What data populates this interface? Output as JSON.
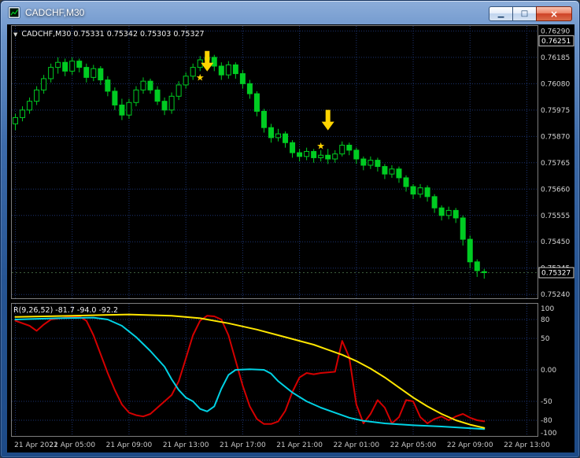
{
  "window": {
    "title": "CADCHF,M30",
    "icons": {
      "minimize": "▁",
      "maximize": "□",
      "close": "×"
    }
  },
  "chart": {
    "collapse_icon": "▼",
    "info_line": "CADCHF,M30 0.75331 0.75342 0.75303 0.75327"
  },
  "indicator": {
    "label": "R(9,26,52) -81.7 -94.0 -92.2"
  },
  "time_axis": {
    "labels": [
      "21 Apr 2022",
      "21 Apr 05:00",
      "21 Apr 09:00",
      "21 Apr 13:00",
      "21 Apr 17:00",
      "21 Apr 21:00",
      "22 Apr 01:00",
      "22 Apr 05:00",
      "22 Apr 09:00",
      "22 Apr 13:00"
    ],
    "indices": [
      0,
      8,
      16,
      24,
      32,
      40,
      48,
      56,
      64,
      72
    ]
  },
  "colors": {
    "background": "#000000",
    "grid": "#1d3472",
    "frame": "#7d7d7d",
    "candle": "#00cc22",
    "bull_fill": "#000000",
    "axis_text": "#d6d6d6",
    "signal": "#ffd400",
    "price_line": "#3c5c3c"
  },
  "chart_data": [
    {
      "type": "candlestick",
      "title": "CADCHF,M30",
      "symbol": "CADCHF",
      "period": "M30",
      "open": "0.75331",
      "high": "0.75342",
      "low": "0.75303",
      "close": "0.75327",
      "ylim": [
        0.75225,
        0.7631
      ],
      "grid_prices": [
        "0.76290",
        "0.76185",
        "0.76080",
        "0.75975",
        "0.75870",
        "0.75765",
        "0.75660",
        "0.75555",
        "0.75450",
        "0.75345",
        "0.75240"
      ],
      "special_price_labels": [
        {
          "text": "0.76251",
          "price": 0.76251
        },
        {
          "text": "0.75327",
          "price": 0.75327
        }
      ],
      "x_tick_indices": [
        0,
        8,
        16,
        24,
        32,
        40,
        48,
        56,
        64,
        72
      ],
      "star_glyph": "★",
      "signals": [
        {
          "shape": "arrow-down",
          "index": 27,
          "price": 0.76129
        },
        {
          "shape": "star",
          "index": 26,
          "price": 0.76105
        },
        {
          "shape": "arrow-down",
          "index": 44,
          "price": 0.75894
        },
        {
          "shape": "star",
          "index": 43,
          "price": 0.75832
        }
      ],
      "candles": [
        [
          0.7592,
          0.7596,
          0.75895,
          0.75945
        ],
        [
          0.75945,
          0.7599,
          0.7593,
          0.75975
        ],
        [
          0.75975,
          0.76025,
          0.7596,
          0.7601
        ],
        [
          0.7601,
          0.7607,
          0.75995,
          0.76055
        ],
        [
          0.76055,
          0.76115,
          0.7604,
          0.761
        ],
        [
          0.761,
          0.7616,
          0.76085,
          0.76145
        ],
        [
          0.76145,
          0.76185,
          0.7612,
          0.76165
        ],
        [
          0.76165,
          0.7618,
          0.7611,
          0.7613
        ],
        [
          0.7613,
          0.76185,
          0.76115,
          0.7617
        ],
        [
          0.7617,
          0.7618,
          0.76125,
          0.76145
        ],
        [
          0.76145,
          0.7616,
          0.76085,
          0.76105
        ],
        [
          0.76105,
          0.76155,
          0.7609,
          0.7614
        ],
        [
          0.7614,
          0.7615,
          0.76075,
          0.76095
        ],
        [
          0.76095,
          0.7611,
          0.7603,
          0.7605
        ],
        [
          0.7605,
          0.76065,
          0.75975,
          0.75995
        ],
        [
          0.75995,
          0.7602,
          0.75935,
          0.75955
        ],
        [
          0.75955,
          0.7602,
          0.7594,
          0.76005
        ],
        [
          0.76005,
          0.7607,
          0.7599,
          0.76055
        ],
        [
          0.76055,
          0.76105,
          0.7604,
          0.7609
        ],
        [
          0.7609,
          0.761,
          0.7604,
          0.76055
        ],
        [
          0.76055,
          0.7607,
          0.75995,
          0.7601
        ],
        [
          0.7601,
          0.76025,
          0.75955,
          0.75975
        ],
        [
          0.75975,
          0.76045,
          0.7596,
          0.7603
        ],
        [
          0.7603,
          0.7609,
          0.76015,
          0.76075
        ],
        [
          0.76075,
          0.76125,
          0.7606,
          0.7611
        ],
        [
          0.7611,
          0.7616,
          0.76095,
          0.76145
        ],
        [
          0.76145,
          0.7619,
          0.7613,
          0.76175
        ],
        [
          0.76175,
          0.762,
          0.7615,
          0.76185
        ],
        [
          0.76185,
          0.76195,
          0.7613,
          0.7615
        ],
        [
          0.7615,
          0.76165,
          0.76095,
          0.76115
        ],
        [
          0.76115,
          0.7617,
          0.761,
          0.76155
        ],
        [
          0.76155,
          0.76165,
          0.761,
          0.7612
        ],
        [
          0.7612,
          0.76135,
          0.7606,
          0.7608
        ],
        [
          0.7608,
          0.76095,
          0.7602,
          0.7604
        ],
        [
          0.7604,
          0.7605,
          0.7595,
          0.7597
        ],
        [
          0.7597,
          0.7598,
          0.75885,
          0.75905
        ],
        [
          0.75905,
          0.7592,
          0.75845,
          0.75865
        ],
        [
          0.75865,
          0.759,
          0.7585,
          0.7588
        ],
        [
          0.7588,
          0.7589,
          0.75825,
          0.75845
        ],
        [
          0.75845,
          0.75855,
          0.75785,
          0.75805
        ],
        [
          0.75805,
          0.7582,
          0.7577,
          0.7579
        ],
        [
          0.7579,
          0.75825,
          0.75775,
          0.7581
        ],
        [
          0.7581,
          0.7582,
          0.75765,
          0.75785
        ],
        [
          0.75785,
          0.75815,
          0.7577,
          0.75795
        ],
        [
          0.75795,
          0.7582,
          0.7576,
          0.7578
        ],
        [
          0.7578,
          0.75815,
          0.75765,
          0.758
        ],
        [
          0.758,
          0.7585,
          0.7579,
          0.75835
        ],
        [
          0.75835,
          0.75845,
          0.75795,
          0.75815
        ],
        [
          0.75815,
          0.75825,
          0.7576,
          0.7578
        ],
        [
          0.7578,
          0.7579,
          0.75735,
          0.75755
        ],
        [
          0.75755,
          0.7579,
          0.7574,
          0.75775
        ],
        [
          0.75775,
          0.75785,
          0.7573,
          0.7575
        ],
        [
          0.7575,
          0.7576,
          0.757,
          0.7572
        ],
        [
          0.7572,
          0.75755,
          0.75705,
          0.7574
        ],
        [
          0.7574,
          0.7575,
          0.75685,
          0.75705
        ],
        [
          0.75705,
          0.75715,
          0.7565,
          0.7567
        ],
        [
          0.7567,
          0.7568,
          0.7562,
          0.7564
        ],
        [
          0.7564,
          0.7568,
          0.75625,
          0.75665
        ],
        [
          0.75665,
          0.75675,
          0.7561,
          0.7563
        ],
        [
          0.7563,
          0.7564,
          0.75565,
          0.75585
        ],
        [
          0.75585,
          0.75595,
          0.75535,
          0.75555
        ],
        [
          0.75555,
          0.7559,
          0.7554,
          0.75575
        ],
        [
          0.75575,
          0.75585,
          0.75525,
          0.75545
        ],
        [
          0.75545,
          0.75555,
          0.75435,
          0.7546
        ],
        [
          0.7546,
          0.75475,
          0.75345,
          0.7537
        ],
        [
          0.7537,
          0.7538,
          0.7531,
          0.75335
        ],
        [
          0.75331,
          0.75342,
          0.75303,
          0.75327
        ]
      ]
    },
    {
      "type": "line",
      "title": "R(9,26,52)",
      "current_values": [
        -81.7,
        -94.0,
        -92.2
      ],
      "ylim": [
        -105,
        105
      ],
      "levels": [
        80,
        50,
        0,
        -50,
        -80
      ],
      "axis_labels": [
        "100",
        "80",
        "50",
        "0.00",
        "-50",
        "-80",
        "-100"
      ],
      "legend_position": "none",
      "series": [
        {
          "name": "red",
          "color": "#d40000",
          "points": [
            [
              0,
              78
            ],
            [
              2,
              70
            ],
            [
              3,
              62
            ],
            [
              4,
              72
            ],
            [
              5,
              80
            ],
            [
              7,
              83
            ],
            [
              9,
              85
            ],
            [
              10,
              78
            ],
            [
              11,
              55
            ],
            [
              12,
              25
            ],
            [
              13,
              -5
            ],
            [
              14,
              -32
            ],
            [
              15,
              -55
            ],
            [
              16,
              -68
            ],
            [
              17,
              -72
            ],
            [
              18,
              -74
            ],
            [
              19,
              -70
            ],
            [
              20,
              -60
            ],
            [
              21,
              -50
            ],
            [
              22,
              -40
            ],
            [
              23,
              -18
            ],
            [
              24,
              18
            ],
            [
              25,
              55
            ],
            [
              26,
              78
            ],
            [
              27,
              86
            ],
            [
              28,
              85
            ],
            [
              29,
              80
            ],
            [
              30,
              55
            ],
            [
              31,
              15
            ],
            [
              32,
              -25
            ],
            [
              33,
              -58
            ],
            [
              34,
              -78
            ],
            [
              35,
              -86
            ],
            [
              36,
              -86
            ],
            [
              37,
              -82
            ],
            [
              38,
              -65
            ],
            [
              39,
              -35
            ],
            [
              40,
              -12
            ],
            [
              41,
              -5
            ],
            [
              42,
              -7
            ],
            [
              43,
              -5
            ],
            [
              44,
              -4
            ],
            [
              45,
              -3
            ],
            [
              46,
              46
            ],
            [
              47,
              20
            ],
            [
              48,
              -55
            ],
            [
              49,
              -85
            ],
            [
              50,
              -70
            ],
            [
              51,
              -48
            ],
            [
              52,
              -60
            ],
            [
              53,
              -85
            ],
            [
              54,
              -75
            ],
            [
              55,
              -48
            ],
            [
              56,
              -50
            ],
            [
              57,
              -75
            ],
            [
              58,
              -85
            ],
            [
              59,
              -78
            ],
            [
              60,
              -74
            ],
            [
              61,
              -80
            ],
            [
              62,
              -74
            ],
            [
              63,
              -70
            ],
            [
              64,
              -76
            ],
            [
              65,
              -80
            ],
            [
              66,
              -81.7
            ]
          ]
        },
        {
          "name": "cyan",
          "color": "#00d2e4",
          "points": [
            [
              0,
              80
            ],
            [
              6,
              82
            ],
            [
              11,
              83
            ],
            [
              13,
              80
            ],
            [
              15,
              70
            ],
            [
              17,
              52
            ],
            [
              19,
              30
            ],
            [
              21,
              5
            ],
            [
              22,
              -15
            ],
            [
              23,
              -32
            ],
            [
              24,
              -44
            ],
            [
              25,
              -50
            ],
            [
              26,
              -62
            ],
            [
              27,
              -66
            ],
            [
              28,
              -58
            ],
            [
              29,
              -30
            ],
            [
              30,
              -8
            ],
            [
              31,
              0
            ],
            [
              33,
              1
            ],
            [
              35,
              0
            ],
            [
              36,
              -6
            ],
            [
              37,
              -18
            ],
            [
              39,
              -36
            ],
            [
              41,
              -50
            ],
            [
              43,
              -60
            ],
            [
              45,
              -68
            ],
            [
              47,
              -76
            ],
            [
              49,
              -81
            ],
            [
              52,
              -85
            ],
            [
              56,
              -88
            ],
            [
              60,
              -90
            ],
            [
              63,
              -92
            ],
            [
              66,
              -94.0
            ]
          ]
        },
        {
          "name": "yellow",
          "color": "#ffe600",
          "points": [
            [
              0,
              84
            ],
            [
              8,
              86
            ],
            [
              16,
              88
            ],
            [
              22,
              86
            ],
            [
              26,
              82
            ],
            [
              30,
              74
            ],
            [
              34,
              64
            ],
            [
              38,
              52
            ],
            [
              42,
              40
            ],
            [
              44,
              32
            ],
            [
              46,
              24
            ],
            [
              48,
              14
            ],
            [
              50,
              2
            ],
            [
              52,
              -12
            ],
            [
              54,
              -28
            ],
            [
              56,
              -44
            ],
            [
              58,
              -58
            ],
            [
              60,
              -70
            ],
            [
              62,
              -80
            ],
            [
              64,
              -87
            ],
            [
              66,
              -92.2
            ]
          ]
        }
      ]
    }
  ]
}
